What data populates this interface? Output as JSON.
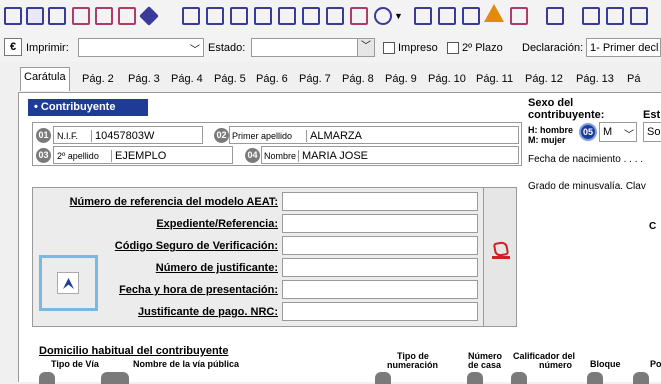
{
  "toolbar": {
    "icons": [
      "new-doc-icon",
      "open-icon",
      "save-icon",
      "cut-icon",
      "print-icon",
      "print-preview-icon",
      "eraser-icon",
      "search-doc-icon",
      "browse-icon",
      "copy-icon",
      "export-icon",
      "import-icon",
      "calculator-icon",
      "pdf-icon",
      "zoom-icon",
      "clipboard-icon",
      "book-icon",
      "tools-icon",
      "warning-icon",
      "user-icon",
      "signature-icon",
      "grid-icon"
    ]
  },
  "filters": {
    "currency_icon": "€",
    "imprimir_label": "Imprimir:",
    "estado_label": "Estado:",
    "impreso_label": "Impreso",
    "segundo_plazo_label": "2º Plazo",
    "declaracion_label": "Declaración:",
    "declaracion_value": "1- Primer decl"
  },
  "tabs": [
    "Carátula",
    "Pág. 2",
    "Pág. 3",
    "Pág. 4",
    "Pág. 5",
    "Pág. 6",
    "Pág. 7",
    "Pág. 8",
    "Pág. 9",
    "Pág. 10",
    "Pág. 11",
    "Pág. 12",
    "Pág. 13",
    "Pá"
  ],
  "contribuyente": {
    "title": "• Contribuyente",
    "nif_num": "01",
    "nif_label": "N.I.F.",
    "nif_value": "10457803W",
    "apellido1_num": "02",
    "apellido1_label": "Primer apellido",
    "apellido1_value": "ALMARZA",
    "apellido2_num": "03",
    "apellido2_label": "2º apellido",
    "apellido2_value": "EJEMPLO",
    "nombre_num": "04",
    "nombre_label": "Nombre",
    "nombre_value": "MARIA JOSE"
  },
  "right": {
    "sexo_label1": "Sexo del",
    "sexo_label2": "contribuyente:",
    "est_label": "Est",
    "hombre": "H: hombre",
    "mujer": "M: mujer",
    "sexo_num": "05",
    "sexo_value": "M",
    "sol_value": "Sol",
    "fecha_nacimiento": "Fecha de nacimiento . . . .",
    "grado": "Grado de minusvalía. Clav",
    "c": "C"
  },
  "aeat": {
    "labels": [
      "Número de referencia del modelo AEAT:",
      "Expediente/Referencia:",
      "Código Seguro de Verificación:",
      "Número de justificante:",
      "Fecha y hora de presentación:",
      "Justificante de pago. NRC:"
    ]
  },
  "domicilio": {
    "title": "Domicilio habitual del contribuyente",
    "tipo_via": "Tipo de Vía",
    "nombre_via": "Nombre de la vía pública",
    "tipo_num1": "Tipo de",
    "tipo_num2": "numeración",
    "numero1": "Número",
    "numero2": "de casa",
    "calif1": "Calificador del",
    "calif2": "número",
    "bloque": "Bloque",
    "po": "Po"
  }
}
